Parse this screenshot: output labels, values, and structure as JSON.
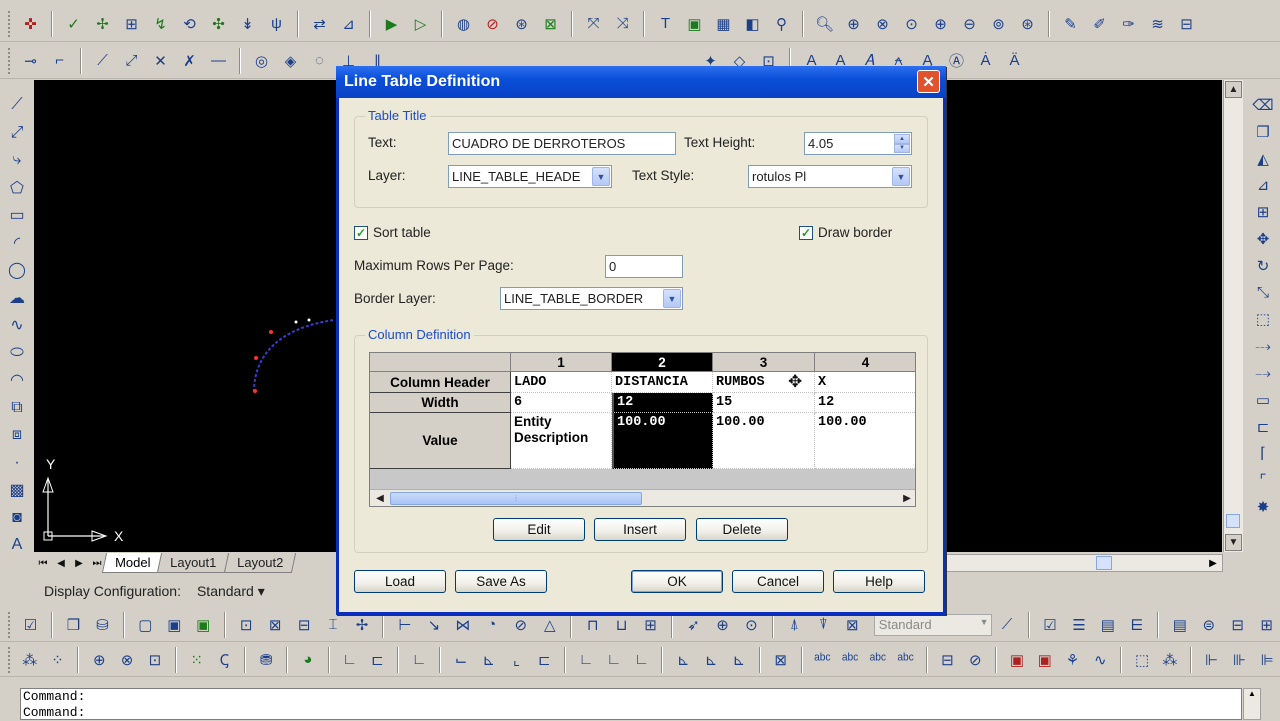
{
  "dialog": {
    "title": "Line Table Definition",
    "close_glyph": "✕",
    "table_title": {
      "group_label": "Table Title",
      "text_label": "Text:",
      "text_value": "CUADRO DE DERROTEROS",
      "text_height_label": "Text Height:",
      "text_height_value": "4.05",
      "layer_label": "Layer:",
      "layer_value": "LINE_TABLE_HEADE",
      "text_style_label": "Text Style:",
      "text_style_value": "rotulos Pl"
    },
    "sort_table_label": "Sort table",
    "sort_table_checked": true,
    "draw_border_label": "Draw border",
    "draw_border_checked": true,
    "max_rows_label": "Maximum Rows Per Page:",
    "max_rows_value": "0",
    "border_layer_label": "Border Layer:",
    "border_layer_value": "LINE_TABLE_BORDER",
    "column_definition": {
      "group_label": "Column Definition",
      "column_numbers": [
        "1",
        "2",
        "3",
        "4"
      ],
      "row_headers": [
        "Column Header",
        "Width",
        "Value"
      ],
      "columns": [
        {
          "header": "LADO",
          "width": "6",
          "value_line1": "Entity",
          "value_line2": "Description"
        },
        {
          "header": "DISTANCIA",
          "width": "12",
          "value_line1": "100.00",
          "value_line2": ""
        },
        {
          "header": "RUMBOS",
          "width": "15",
          "value_line1": "100.00",
          "value_line2": ""
        },
        {
          "header": "X",
          "width": "12",
          "value_line1": "100.00",
          "value_line2": ""
        }
      ],
      "selected_column": "2",
      "edit_button": "Edit",
      "insert_button": "Insert",
      "delete_button": "Delete"
    },
    "load_button": "Load",
    "save_as_button": "Save As",
    "ok_button": "OK",
    "cancel_button": "Cancel",
    "help_button": "Help"
  },
  "layout_tabs": [
    "Model",
    "Layout1",
    "Layout2"
  ],
  "active_tab": "Model",
  "display_config": {
    "label": "Display Configuration:",
    "value": "Standard"
  },
  "toolbar_style_combo": "Standard",
  "axis_labels": {
    "y": "Y",
    "x": "X"
  },
  "command_lines": [
    "Command:",
    "Command:"
  ],
  "colors": {
    "canvas": "#000000",
    "titlebar": "#0a4fd8",
    "accent_label": "#1c4cc8",
    "curve": "#3b3bd6"
  }
}
